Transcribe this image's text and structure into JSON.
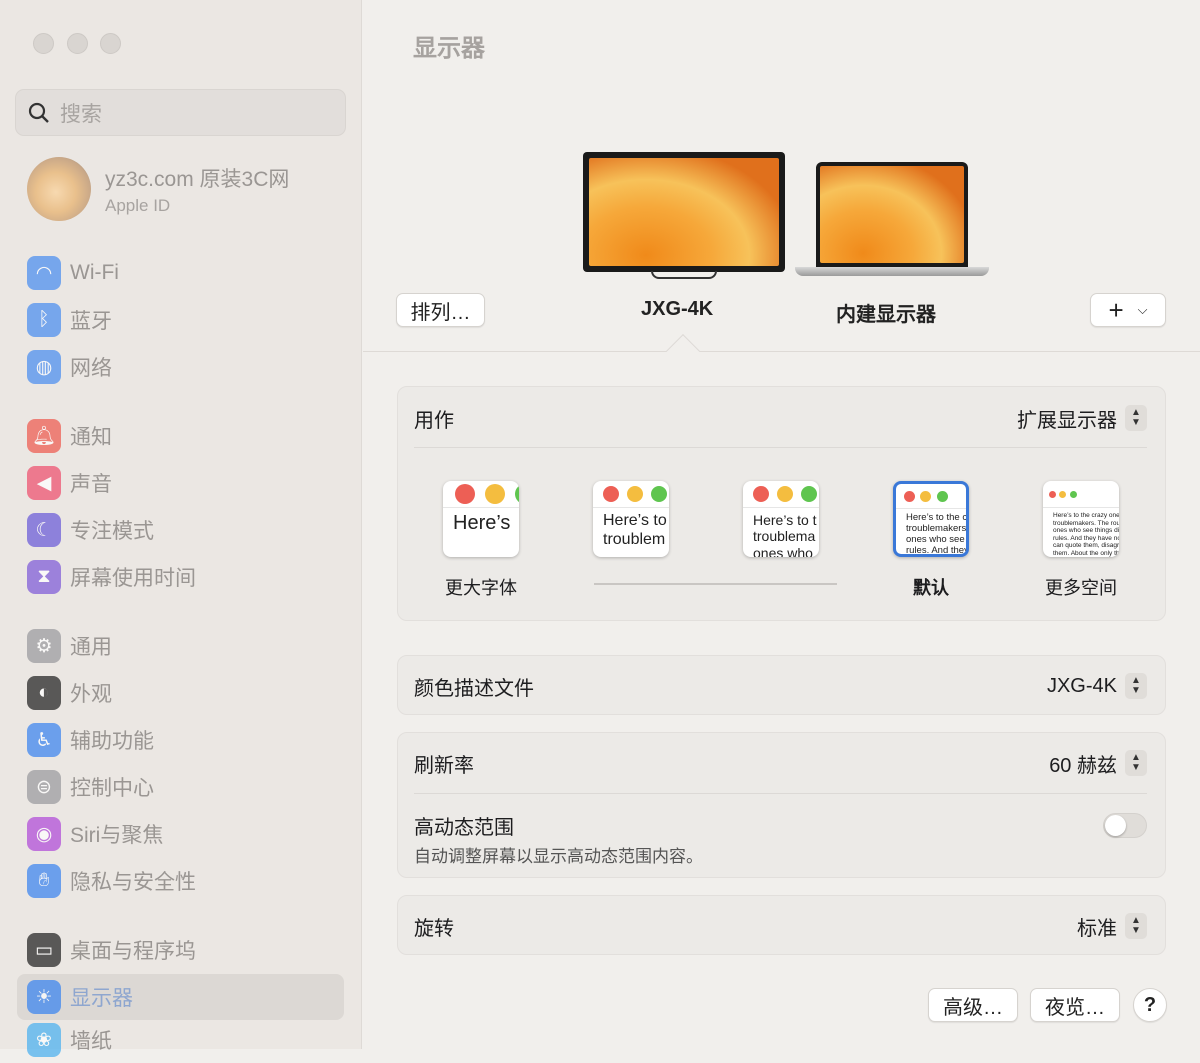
{
  "sidebar": {
    "search_placeholder": "搜索",
    "account": {
      "name": "yz3c.com 原装3C网",
      "sub": "Apple ID"
    },
    "items": [
      {
        "label": "Wi-Fi",
        "icon": "wifi-icon",
        "color": "#4a8ef0"
      },
      {
        "label": "蓝牙",
        "icon": "bluetooth-icon",
        "color": "#4a8ef0"
      },
      {
        "label": "网络",
        "icon": "globe-icon",
        "color": "#4a8ef0"
      },
      {
        "label": "通知",
        "icon": "bell-icon",
        "color": "#ee5a4f"
      },
      {
        "label": "声音",
        "icon": "speaker-icon",
        "color": "#ee4f6e"
      },
      {
        "label": "专注模式",
        "icon": "moon-icon",
        "color": "#6a5ad8"
      },
      {
        "label": "屏幕使用时间",
        "icon": "hourglass-icon",
        "color": "#7f5ad8"
      },
      {
        "label": "通用",
        "icon": "gear-icon",
        "color": "#9a9a9e"
      },
      {
        "label": "外观",
        "icon": "appearance-icon",
        "color": "#222222"
      },
      {
        "label": "辅助功能",
        "icon": "accessibility-icon",
        "color": "#3a84f0"
      },
      {
        "label": "控制中心",
        "icon": "toggles-icon",
        "color": "#9a9a9e"
      },
      {
        "label": "Siri与聚焦",
        "icon": "siri-icon",
        "color": "#b04ad8"
      },
      {
        "label": "隐私与安全性",
        "icon": "hand-icon",
        "color": "#3a84f0"
      },
      {
        "label": "桌面与程序坞",
        "icon": "dock-icon",
        "color": "#222222"
      },
      {
        "label": "显示器",
        "icon": "sun-icon",
        "color": "#3a84f0",
        "selected": true
      },
      {
        "label": "墙纸",
        "icon": "wallpaper-icon",
        "color": "#4ab0f0"
      }
    ]
  },
  "main": {
    "title": "显示器",
    "arrange_button": "排列…",
    "add_button": "+",
    "displays": [
      {
        "name": "JXG-4K",
        "selected": true
      },
      {
        "name": "内建显示器"
      }
    ],
    "use_as": {
      "label": "用作",
      "value": "扩展显示器"
    },
    "resolution": {
      "options": [
        {
          "label": "更大字体",
          "text": "Here’s",
          "size": 20
        },
        {
          "label": "",
          "text": "Here’s to\ntroublem",
          "size": 16
        },
        {
          "label": "",
          "text": "Here’s to t\ntroublema\nones who",
          "size": 14
        },
        {
          "label": "默认",
          "text": "Here’s to the cr\ntroublemakers.\nones who see t\nrules. And they",
          "size": 9.5,
          "selected": true
        },
        {
          "label": "更多空间",
          "text": "Here’s to the crazy one\ntroublemakers. The rou\nones who see things dif\nrules. And they have no\ncan quote them, disagre\nthem. About the only th\nBecause they change th",
          "size": 6.5
        }
      ]
    },
    "color_profile": {
      "label": "颜色描述文件",
      "value": "JXG-4K"
    },
    "refresh_rate": {
      "label": "刷新率",
      "value": "60 赫兹"
    },
    "hdr": {
      "label": "高动态范围",
      "description": "自动调整屏幕以显示高动态范围内容。",
      "enabled": false
    },
    "rotation": {
      "label": "旋转",
      "value": "标准"
    },
    "buttons": {
      "advanced": "高级…",
      "night_shift": "夜览…",
      "help": "?"
    }
  }
}
